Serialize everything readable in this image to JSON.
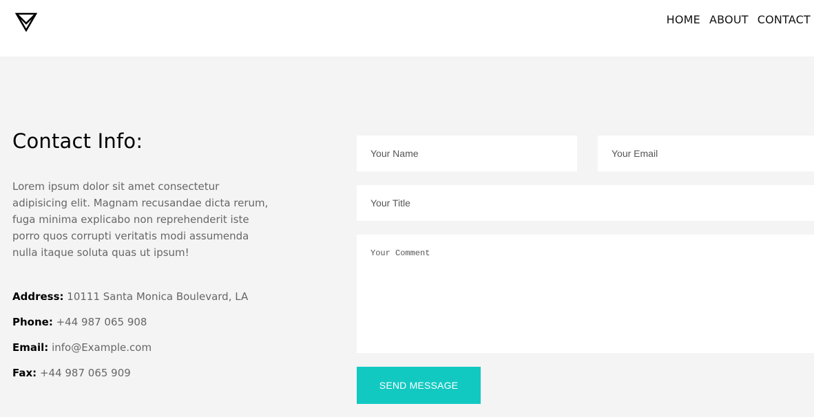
{
  "header": {
    "logo_icon": "inverted-triangle-logo-icon",
    "nav": [
      {
        "label": "HOME"
      },
      {
        "label": "ABOUT"
      },
      {
        "label": "CONTACT"
      }
    ]
  },
  "contact": {
    "title": "Contact Info:",
    "description": "Lorem ipsum dolor sit amet consectetur adipisicing elit. Magnam recusandae dicta rerum, fuga minima explicabo non reprehenderit iste porro quos corrupti veritatis modi assumenda nulla itaque soluta quas ut ipsum!",
    "details": {
      "address": {
        "label": "Address:",
        "value": "10111 Santa Monica Boulevard, LA"
      },
      "phone": {
        "label": "Phone:",
        "value": "+44 987 065 908"
      },
      "email": {
        "label": "Email:",
        "value": "info@Example.com"
      },
      "fax": {
        "label": "Fax:",
        "value": "+44 987 065 909"
      }
    }
  },
  "form": {
    "name_placeholder": "Your Name",
    "email_placeholder": "Your Email",
    "title_placeholder": "Your Title",
    "comment_placeholder": "Your Comment",
    "submit_label": "SEND MESSAGE"
  },
  "colors": {
    "accent": "#12c9c2",
    "section_background": "#f4f4f4",
    "body_text": "#666666"
  }
}
